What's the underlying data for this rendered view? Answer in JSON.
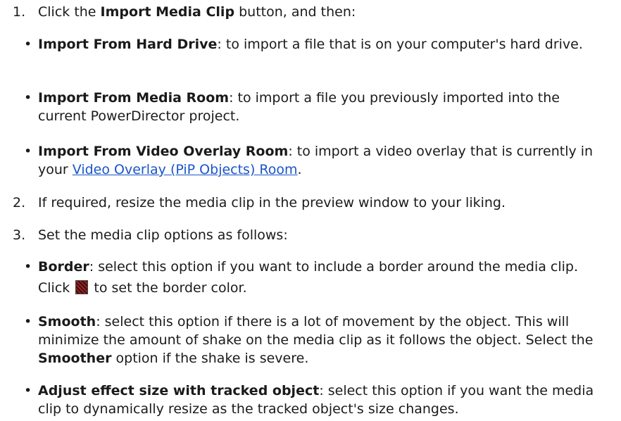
{
  "steps": [
    {
      "number": "1.",
      "before": "Click the ",
      "bold": "Import Media Clip",
      "after": " button, and then:"
    },
    {
      "number": "2.",
      "text": "If required, resize the media clip in the preview window to your liking."
    },
    {
      "number": "3.",
      "text": "Set the media clip options as follows:"
    }
  ],
  "import_options": [
    {
      "bold": "Import From Hard Drive",
      "rest": ": to import a file that is on your computer's hard drive."
    },
    {
      "bold": "Import From Media Room",
      "rest": ": to import a file you previously imported into the current PowerDirector project."
    },
    {
      "bold": "Import From Video Overlay Room",
      "rest": ": to import a video overlay that is currently in your ",
      "link": "Video Overlay (PiP Objects) Room",
      "end": "."
    }
  ],
  "clip_options": [
    {
      "bold": "Border",
      "rest": ": select this option if you want to include a border around the media clip. Click ",
      "icon": "border-color-swatch-icon",
      "after_icon": " to set the border color."
    },
    {
      "bold": "Smooth",
      "rest": ": select this option if there is a lot of movement by the object. This will minimize the amount of shake on the media clip as it follows the object. Select the ",
      "bold2": "Smoother",
      "rest2": " option if the shake is severe."
    },
    {
      "bold": "Adjust effect size with tracked object",
      "rest": ": select this option if you want the media clip to dynamically resize as the tracked object's size changes."
    }
  ],
  "colors": {
    "text": "#1a1a1a",
    "link": "#1a55c9"
  }
}
